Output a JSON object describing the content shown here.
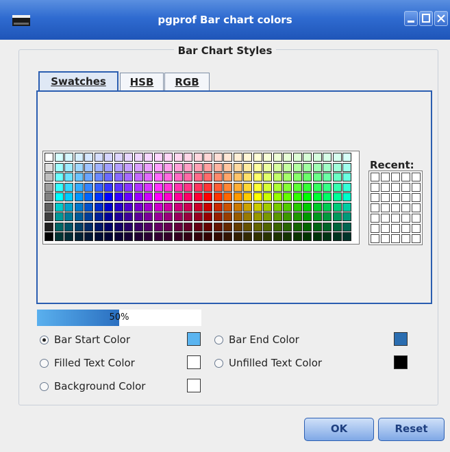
{
  "window": {
    "title": "pgprof Bar chart colors"
  },
  "group": {
    "title": "Bar Chart Styles"
  },
  "tabs": [
    {
      "label": "Swatches",
      "active": true
    },
    {
      "label": "HSB",
      "active": false
    },
    {
      "label": "RGB",
      "active": false
    }
  ],
  "recent": {
    "label": "Recent:"
  },
  "progress": {
    "value": 0.5,
    "label": "50%"
  },
  "options": {
    "bar_start": {
      "label": "Bar Start Color",
      "selected": true,
      "color": "#5ab4f0"
    },
    "bar_end": {
      "label": "Bar End Color",
      "selected": false,
      "color": "#2a6db0"
    },
    "filled_text": {
      "label": "Filled Text Color",
      "selected": false,
      "color": "#ffffff"
    },
    "unfilled_text": {
      "label": "Unfilled Text Color",
      "selected": false,
      "color": "#000000"
    },
    "background": {
      "label": "Background Color",
      "selected": false,
      "color": "#ffffff"
    }
  },
  "buttons": {
    "ok": "OK",
    "reset": "Reset"
  },
  "icons": [
    "app-icon",
    "minimize-icon",
    "maximize-icon",
    "close-icon"
  ]
}
